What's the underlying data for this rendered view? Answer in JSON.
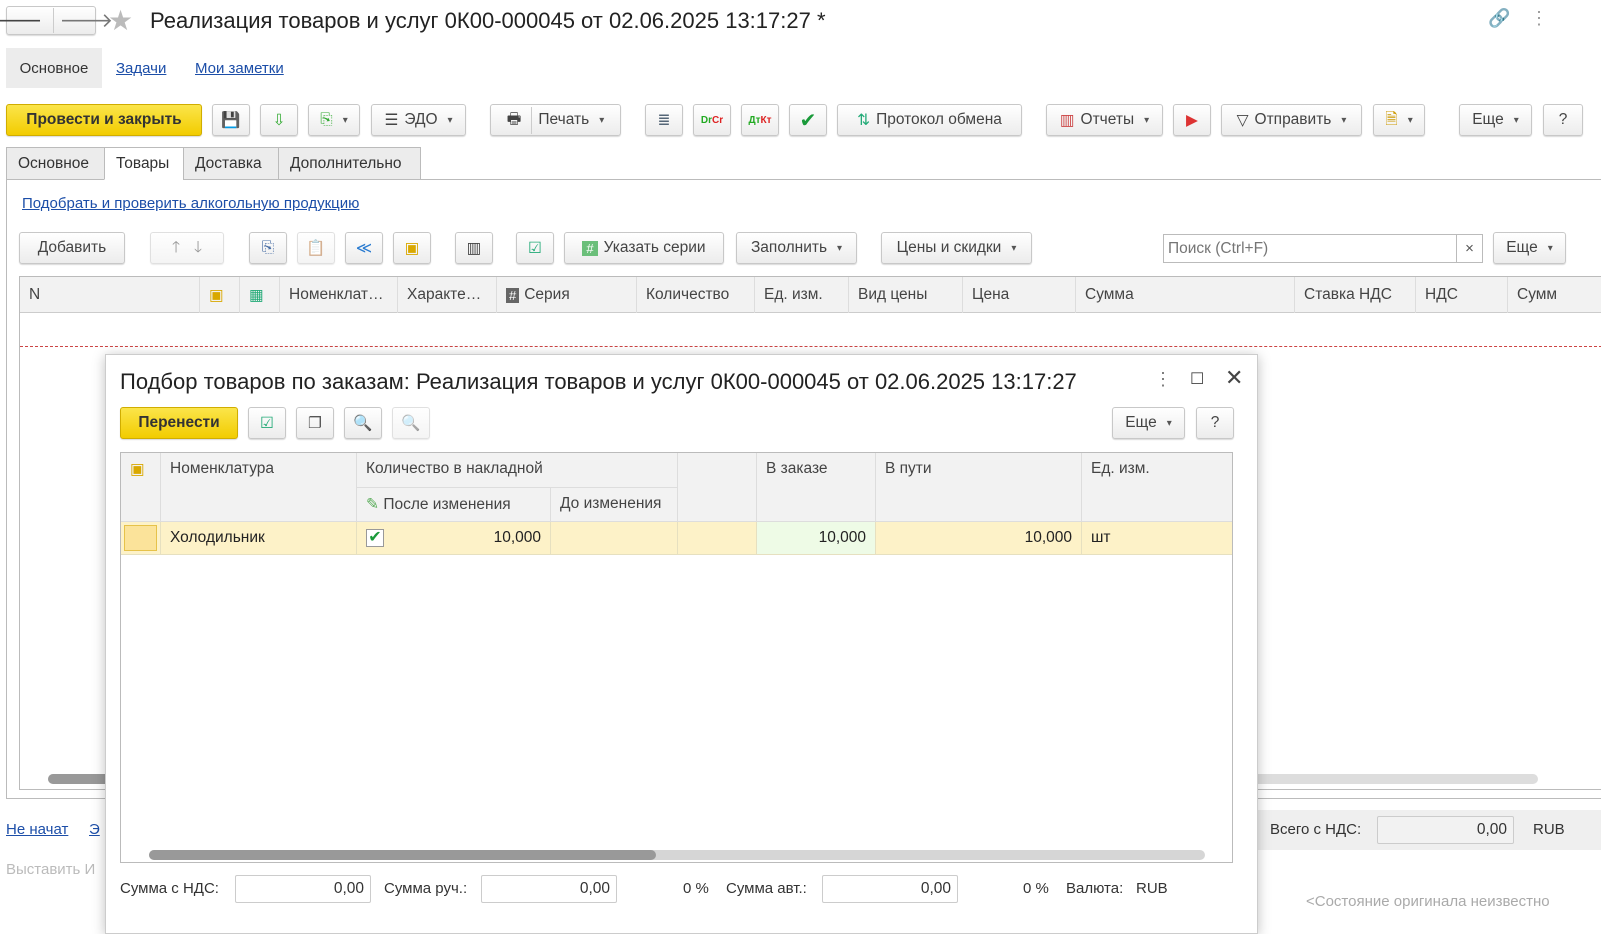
{
  "window": {
    "title": "Реализация товаров и услуг 0К00-000045 от 02.06.2025 13:17:27 *"
  },
  "nav_links": [
    "Основное",
    "Задачи",
    "Мои заметки"
  ],
  "toolbar": {
    "post_close": "Провести и закрыть",
    "edo": "ЭДО",
    "print": "Печать",
    "exchange_log": "Протокол обмена",
    "reports": "Отчеты",
    "send": "Отправить",
    "more": "Еще",
    "help": "?"
  },
  "tabs": [
    "Основное",
    "Товары",
    "Доставка",
    "Дополнительно"
  ],
  "alco_link": "Подобрать и проверить алкогольную продукцию",
  "goods_toolbar": {
    "add": "Добавить",
    "series": "Указать серии",
    "fill": "Заполнить",
    "prices": "Цены и скидки",
    "search_placeholder": "Поиск (Ctrl+F)",
    "clear": "×",
    "more": "Еще"
  },
  "goods_columns": [
    "N",
    "Номенклат…",
    "Характе…",
    "Серия",
    "Количество",
    "Ед. изм.",
    "Вид цены",
    "Цена",
    "Сумма",
    "Ставка НДС",
    "НДС",
    "Сумм"
  ],
  "footer": {
    "status_link": "Не начат",
    "status_link2": "Э",
    "invoice": "Выставить И",
    "total_label": "Всего с НДС:",
    "total_value": "0,00",
    "currency": "RUB",
    "original_state": "<Состояние оригинала неизвестно"
  },
  "dialog": {
    "title": "Подбор товаров по заказам: Реализация товаров и услуг 0К00-000045 от 02.06.2025 13:17:27",
    "transfer": "Перенести",
    "more": "Еще",
    "help": "?",
    "headers": {
      "nomenclature": "Номенклатура",
      "qty_group": "Количество в накладной",
      "after": "После изменения",
      "before": "До изменения",
      "in_order": "В заказе",
      "in_transit": "В пути",
      "unit": "Ед. изм."
    },
    "rows": [
      {
        "nomenclature": "Холодильник",
        "checked": true,
        "after": "10,000",
        "before": "",
        "in_order": "10,000",
        "in_transit": "10,000",
        "unit": "шт"
      }
    ],
    "footer": {
      "sum_vat_label": "Сумма с НДС:",
      "sum_vat": "0,00",
      "manual_label": "Сумма руч.:",
      "manual": "0,00",
      "manual_pct": "0 %",
      "auto_label": "Сумма авт.:",
      "auto": "0,00",
      "auto_pct": "0 %",
      "currency_label": "Валюта:",
      "currency": "RUB"
    }
  },
  "colors": {
    "accent": "#f2cc00",
    "link": "#1c4ea8",
    "row_highlight": "#fdf2c8"
  }
}
